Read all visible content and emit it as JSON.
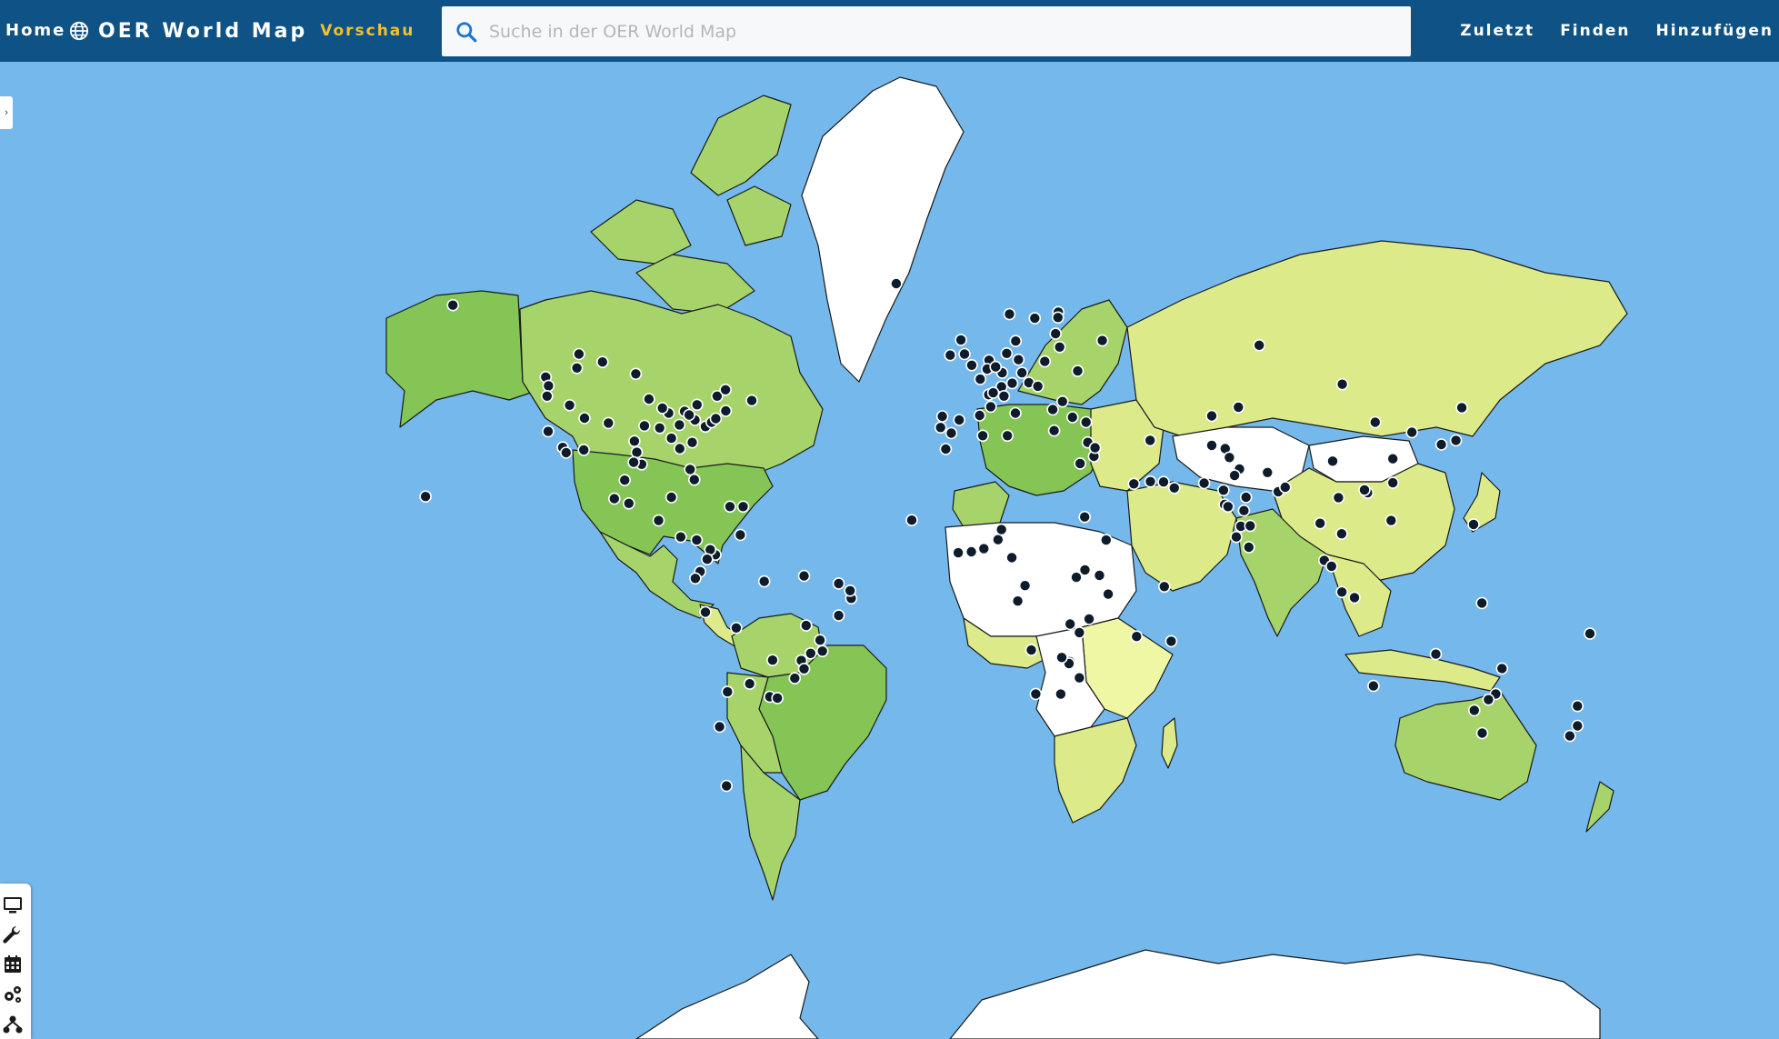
{
  "header": {
    "home_label": "Home",
    "brand_title": "OER World Map",
    "brand_badge": "Vorschau",
    "search_placeholder": "Suche in der OER World Map",
    "nav": [
      {
        "label": "Zuletzt"
      },
      {
        "label": "Finden"
      },
      {
        "label": "Hinzufügen"
      }
    ]
  },
  "map": {
    "ocean_color": "#74b8ec",
    "country_colors": {
      "no_data": "#ffffff",
      "level_1": "#f0f7a4",
      "level_2": "#dcea8a",
      "level_3": "#a7d46a",
      "level_4": "#84c555"
    },
    "marker_color": "#0d1b2a",
    "markers": [
      {
        "lat": 61.2,
        "lon": -149.9
      },
      {
        "lat": 49.3,
        "lon": -123.1
      },
      {
        "lat": 47.6,
        "lon": -122.3
      },
      {
        "lat": 45.5,
        "lon": -122.7
      },
      {
        "lat": 37.8,
        "lon": -122.4
      },
      {
        "lat": 34.0,
        "lon": -118.2
      },
      {
        "lat": 32.7,
        "lon": -117.2
      },
      {
        "lat": 33.4,
        "lon": -112.1
      },
      {
        "lat": 39.7,
        "lon": -105.0
      },
      {
        "lat": 40.8,
        "lon": -111.9
      },
      {
        "lat": 43.6,
        "lon": -116.2
      },
      {
        "lat": 44.9,
        "lon": -93.3
      },
      {
        "lat": 41.9,
        "lon": -87.6
      },
      {
        "lat": 39.1,
        "lon": -94.6
      },
      {
        "lat": 32.8,
        "lon": -96.8
      },
      {
        "lat": 29.8,
        "lon": -95.4
      },
      {
        "lat": 30.3,
        "lon": -97.7
      },
      {
        "lat": 35.5,
        "lon": -97.5
      },
      {
        "lat": 38.6,
        "lon": -90.2
      },
      {
        "lat": 36.2,
        "lon": -86.8
      },
      {
        "lat": 33.7,
        "lon": -84.4
      },
      {
        "lat": 25.8,
        "lon": -80.2
      },
      {
        "lat": 28.5,
        "lon": -81.4
      },
      {
        "lat": 35.2,
        "lon": -80.8
      },
      {
        "lat": 38.9,
        "lon": -77.0
      },
      {
        "lat": 39.9,
        "lon": -75.2
      },
      {
        "lat": 40.7,
        "lon": -74.0
      },
      {
        "lat": 42.4,
        "lon": -71.1
      },
      {
        "lat": 43.7,
        "lon": -79.4
      },
      {
        "lat": 45.5,
        "lon": -73.6
      },
      {
        "lat": 46.8,
        "lon": -71.2
      },
      {
        "lat": 44.6,
        "lon": -63.6
      },
      {
        "lat": 53.5,
        "lon": -113.5
      },
      {
        "lat": 51.0,
        "lon": -114.1
      },
      {
        "lat": 49.9,
        "lon": -97.1
      },
      {
        "lat": 52.1,
        "lon": -106.7
      },
      {
        "lat": 42.3,
        "lon": -83.0
      },
      {
        "lat": 40.4,
        "lon": -80.0
      },
      {
        "lat": 39.3,
        "lon": -84.5
      },
      {
        "lat": 41.5,
        "lon": -81.7
      },
      {
        "lat": 43.0,
        "lon": -89.4
      },
      {
        "lat": 19.4,
        "lon": -99.1
      },
      {
        "lat": 20.7,
        "lon": -103.3
      },
      {
        "lat": 25.7,
        "lon": -100.3
      },
      {
        "lat": 21.1,
        "lon": -86.8
      },
      {
        "lat": 18.5,
        "lon": -69.9
      },
      {
        "lat": 18.5,
        "lon": -66.1
      },
      {
        "lat": 14.6,
        "lon": -90.5
      },
      {
        "lat": 9.9,
        "lon": -84.1
      },
      {
        "lat": 9.0,
        "lon": -79.5
      },
      {
        "lat": 10.5,
        "lon": -66.9
      },
      {
        "lat": 4.7,
        "lon": -74.1
      },
      {
        "lat": 6.2,
        "lon": -75.6
      },
      {
        "lat": 3.4,
        "lon": -76.5
      },
      {
        "lat": -0.2,
        "lon": -78.5
      },
      {
        "lat": -2.2,
        "lon": -79.9
      },
      {
        "lat": -12.0,
        "lon": -77.0
      },
      {
        "lat": -16.5,
        "lon": -68.1
      },
      {
        "lat": -33.4,
        "lon": -70.6
      },
      {
        "lat": -34.6,
        "lon": -58.4
      },
      {
        "lat": -31.4,
        "lon": -64.2
      },
      {
        "lat": -34.9,
        "lon": -56.2
      },
      {
        "lat": -25.3,
        "lon": -57.6
      },
      {
        "lat": -23.5,
        "lon": -46.6
      },
      {
        "lat": -22.9,
        "lon": -43.2
      },
      {
        "lat": -19.9,
        "lon": -43.9
      },
      {
        "lat": -15.8,
        "lon": -47.9
      },
      {
        "lat": -25.4,
        "lon": -49.3
      },
      {
        "lat": -30.0,
        "lon": -51.2
      },
      {
        "lat": -12.97,
        "lon": -38.5
      },
      {
        "lat": -8.05,
        "lon": -34.9
      },
      {
        "lat": -3.7,
        "lon": -38.5
      },
      {
        "lat": -3.1,
        "lon": -60.0
      },
      {
        "lat": -1.5,
        "lon": -48.5
      },
      {
        "lat": -5.8,
        "lon": -35.2
      },
      {
        "lat": -41.5,
        "lon": -72.9
      },
      {
        "lat": -53.2,
        "lon": -70.9
      },
      {
        "lat": -27.6,
        "lon": -48.5
      },
      {
        "lat": 64.1,
        "lon": -21.9
      },
      {
        "lat": 51.5,
        "lon": -0.1
      },
      {
        "lat": 53.5,
        "lon": -2.2
      },
      {
        "lat": 55.9,
        "lon": -3.2
      },
      {
        "lat": 53.3,
        "lon": -6.3
      },
      {
        "lat": 48.9,
        "lon": 2.35
      },
      {
        "lat": 45.8,
        "lon": 4.8
      },
      {
        "lat": 43.3,
        "lon": 5.4
      },
      {
        "lat": 52.4,
        "lon": 4.9
      },
      {
        "lat": 50.8,
        "lon": 4.35
      },
      {
        "lat": 52.5,
        "lon": 13.4
      },
      {
        "lat": 48.1,
        "lon": 11.6
      },
      {
        "lat": 50.1,
        "lon": 8.7
      },
      {
        "lat": 53.6,
        "lon": 10.0
      },
      {
        "lat": 51.2,
        "lon": 6.8
      },
      {
        "lat": 47.4,
        "lon": 8.5
      },
      {
        "lat": 46.2,
        "lon": 6.1
      },
      {
        "lat": 48.2,
        "lon": 16.4
      },
      {
        "lat": 50.1,
        "lon": 14.4
      },
      {
        "lat": 52.2,
        "lon": 21.0
      },
      {
        "lat": 47.5,
        "lon": 19.0
      },
      {
        "lat": 44.4,
        "lon": 26.1
      },
      {
        "lat": 42.7,
        "lon": 23.3
      },
      {
        "lat": 37.98,
        "lon": 23.7
      },
      {
        "lat": 41.9,
        "lon": 12.5
      },
      {
        "lat": 45.5,
        "lon": 9.2
      },
      {
        "lat": 40.4,
        "lon": -3.7
      },
      {
        "lat": 41.4,
        "lon": 2.2
      },
      {
        "lat": 38.7,
        "lon": -9.1
      },
      {
        "lat": 41.2,
        "lon": -8.6
      },
      {
        "lat": 37.4,
        "lon": -6.0
      },
      {
        "lat": 55.7,
        "lon": 12.6
      },
      {
        "lat": 59.3,
        "lon": 18.1
      },
      {
        "lat": 59.9,
        "lon": 10.8
      },
      {
        "lat": 60.2,
        "lon": 24.9
      },
      {
        "lat": 59.4,
        "lon": 24.8
      },
      {
        "lat": 56.9,
        "lon": 24.1
      },
      {
        "lat": 54.7,
        "lon": 25.3
      },
      {
        "lat": 50.45,
        "lon": 30.5
      },
      {
        "lat": 55.8,
        "lon": 37.6
      },
      {
        "lat": 41.0,
        "lon": 29.0
      },
      {
        "lat": 39.9,
        "lon": 32.9
      },
      {
        "lat": 35.2,
        "lon": 33.4
      },
      {
        "lat": 31.8,
        "lon": 35.2
      },
      {
        "lat": 33.9,
        "lon": 35.5
      },
      {
        "lat": 30.0,
        "lon": 31.2
      },
      {
        "lat": 24.7,
        "lon": 46.7
      },
      {
        "lat": 25.3,
        "lon": 51.5
      },
      {
        "lat": 25.2,
        "lon": 55.3
      },
      {
        "lat": 23.6,
        "lon": 58.4
      },
      {
        "lat": 35.7,
        "lon": 51.4
      },
      {
        "lat": 34.5,
        "lon": 69.2
      },
      {
        "lat": 33.7,
        "lon": 73.1
      },
      {
        "lat": 31.5,
        "lon": 74.3
      },
      {
        "lat": 24.9,
        "lon": 67.0
      },
      {
        "lat": 28.6,
        "lon": 77.2
      },
      {
        "lat": 19.1,
        "lon": 72.9
      },
      {
        "lat": 12.97,
        "lon": 77.6
      },
      {
        "lat": 13.1,
        "lon": 80.3
      },
      {
        "lat": 17.4,
        "lon": 78.5
      },
      {
        "lat": 22.6,
        "lon": 88.4
      },
      {
        "lat": 23.8,
        "lon": 90.4
      },
      {
        "lat": 27.7,
        "lon": 85.3
      },
      {
        "lat": 6.9,
        "lon": 79.9
      },
      {
        "lat": 26.9,
        "lon": 75.8
      },
      {
        "lat": 18.5,
        "lon": 73.9
      },
      {
        "lat": 21.1,
        "lon": 79.1
      },
      {
        "lat": 23.0,
        "lon": 72.6
      },
      {
        "lat": 9.9,
        "lon": 76.3
      },
      {
        "lat": 13.8,
        "lon": 100.5
      },
      {
        "lat": 21.0,
        "lon": 105.8
      },
      {
        "lat": 10.8,
        "lon": 106.7
      },
      {
        "lat": 3.1,
        "lon": 101.7
      },
      {
        "lat": 1.35,
        "lon": 103.8
      },
      {
        "lat": -6.2,
        "lon": 106.8
      },
      {
        "lat": -7.8,
        "lon": 110.4
      },
      {
        "lat": 14.6,
        "lon": 121.0
      },
      {
        "lat": 39.9,
        "lon": 116.4
      },
      {
        "lat": 31.2,
        "lon": 121.5
      },
      {
        "lat": 22.3,
        "lon": 114.2
      },
      {
        "lat": 23.1,
        "lon": 113.3
      },
      {
        "lat": 30.6,
        "lon": 104.1
      },
      {
        "lat": 25.0,
        "lon": 121.5
      },
      {
        "lat": 37.6,
        "lon": 127.0
      },
      {
        "lat": 35.7,
        "lon": 139.7
      },
      {
        "lat": 34.7,
        "lon": 135.5
      },
      {
        "lat": 43.1,
        "lon": 141.4
      },
      {
        "lat": 55.0,
        "lon": 82.9
      },
      {
        "lat": 47.9,
        "lon": 106.9
      },
      {
        "lat": 43.2,
        "lon": 76.9
      },
      {
        "lat": 41.3,
        "lon": 69.2
      },
      {
        "lat": 14.7,
        "lon": -17.4
      },
      {
        "lat": 5.6,
        "lon": -0.2
      },
      {
        "lat": 6.5,
        "lon": 3.4
      },
      {
        "lat": 9.1,
        "lon": 7.5
      },
      {
        "lat": 12.0,
        "lon": 8.5
      },
      {
        "lat": 3.9,
        "lon": 11.5
      },
      {
        "lat": 5.3,
        "lon": -4.0
      },
      {
        "lat": 33.6,
        "lon": -7.6
      },
      {
        "lat": 36.8,
        "lon": 10.2
      },
      {
        "lat": 36.8,
        "lon": 3.1
      },
      {
        "lat": 15.6,
        "lon": 32.5
      },
      {
        "lat": 9.0,
        "lon": 38.7
      },
      {
        "lat": -1.3,
        "lon": 36.8
      },
      {
        "lat": 0.3,
        "lon": 32.6
      },
      {
        "lat": -1.9,
        "lon": 30.1
      },
      {
        "lat": -6.8,
        "lon": 39.3
      },
      {
        "lat": -4.3,
        "lon": 15.3
      },
      {
        "lat": -8.8,
        "lon": 13.2
      },
      {
        "lat": -15.4,
        "lon": 28.3
      },
      {
        "lat": -17.8,
        "lon": 31.0
      },
      {
        "lat": -13.96,
        "lon": 33.8
      },
      {
        "lat": -25.7,
        "lon": 28.2
      },
      {
        "lat": -26.2,
        "lon": 28.0
      },
      {
        "lat": -29.9,
        "lon": 31.0
      },
      {
        "lat": -33.9,
        "lon": 18.4
      },
      {
        "lat": -33.96,
        "lon": 25.6
      },
      {
        "lat": -22.6,
        "lon": 17.1
      },
      {
        "lat": -24.6,
        "lon": 25.9
      },
      {
        "lat": -18.9,
        "lon": 47.5
      },
      {
        "lat": -20.2,
        "lon": 57.5
      },
      {
        "lat": -4.6,
        "lon": 55.5
      },
      {
        "lat": -33.9,
        "lon": 151.2
      },
      {
        "lat": -37.8,
        "lon": 145.0
      },
      {
        "lat": -27.5,
        "lon": 153.0
      },
      {
        "lat": -31.95,
        "lon": 115.9
      },
      {
        "lat": -35.3,
        "lon": 149.1
      },
      {
        "lat": -42.9,
        "lon": 147.3
      },
      {
        "lat": -23.7,
        "lon": 133.9
      },
      {
        "lat": -36.8,
        "lon": 174.8
      },
      {
        "lat": -41.3,
        "lon": 174.8
      },
      {
        "lat": -43.5,
        "lon": 172.6
      },
      {
        "lat": -18.1,
        "lon": 178.4
      },
      {
        "lat": 21.3,
        "lon": -157.8
      },
      {
        "lat": -9.4,
        "lon": 147.2
      },
      {
        "lat": 13.5,
        "lon": 144.8
      }
    ]
  },
  "toolbar": {
    "items": [
      {
        "icon": "monitor-icon"
      },
      {
        "icon": "wrench-icon"
      },
      {
        "icon": "calendar-icon"
      },
      {
        "icon": "gears-icon"
      },
      {
        "icon": "network-icon"
      }
    ]
  }
}
